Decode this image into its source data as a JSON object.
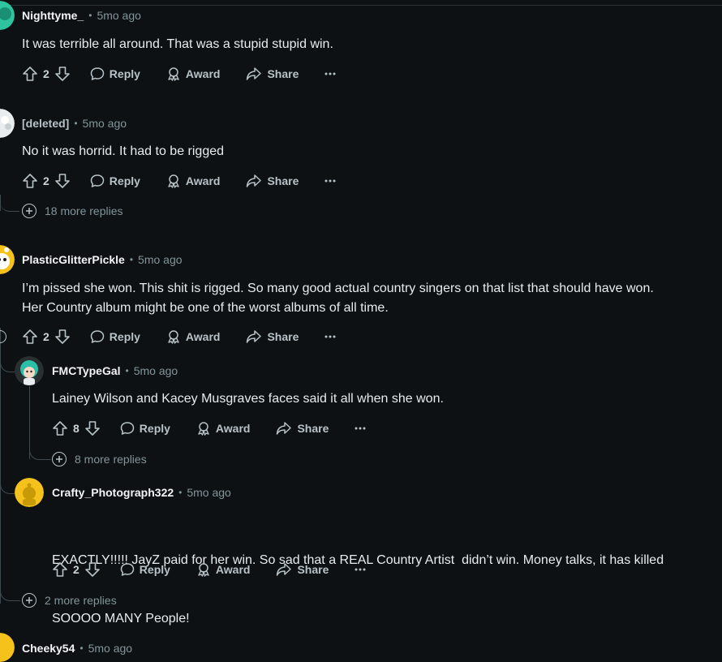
{
  "comments": [
    {
      "user": "Nighttyme_",
      "time": "5mo ago",
      "text": "It was terrible all around. That was a stupid stupid win.",
      "votes": "2"
    },
    {
      "user": "[deleted]",
      "time": "5mo ago",
      "text": "No it was horrid. It had to be rigged",
      "votes": "2",
      "more_replies": "18 more replies"
    },
    {
      "user": "PlasticGlitterPickle",
      "time": "5mo ago",
      "text1": "I’m pissed she won. This shit is rigged. So many good actual country singers on that list that should have won.",
      "text2": "Her Country album might be one of the worst albums of all time.",
      "votes": "2"
    },
    {
      "user": "FMCTypeGal",
      "time": "5mo ago",
      "text": "Lainey Wilson and Kacey Musgraves faces said it all when she won.",
      "votes": "8",
      "more_replies": "8 more replies"
    },
    {
      "user": "Crafty_Photograph322",
      "time": "5mo ago",
      "text1": "EXACTLY!!!!! JayZ paid for her win. So sad that a REAL Country Artist  didn’t win. Money talks, it has killed",
      "text2": "SOOOO MANY People!",
      "votes": "2",
      "more_replies": "2 more replies"
    },
    {
      "user": "Cheeky54",
      "time": "5mo ago"
    }
  ],
  "labels": {
    "reply": "Reply",
    "award": "Award",
    "share": "Share",
    "separator": "•"
  },
  "icons": [
    "upvote-icon",
    "downvote-icon",
    "reply-icon",
    "award-icon",
    "share-icon",
    "more-options-icon",
    "plus-circle-icon"
  ],
  "colors": {
    "background": "#0e1113",
    "text": "#f2f4f5",
    "muted": "#82959b",
    "action": "#b7c3c8"
  }
}
